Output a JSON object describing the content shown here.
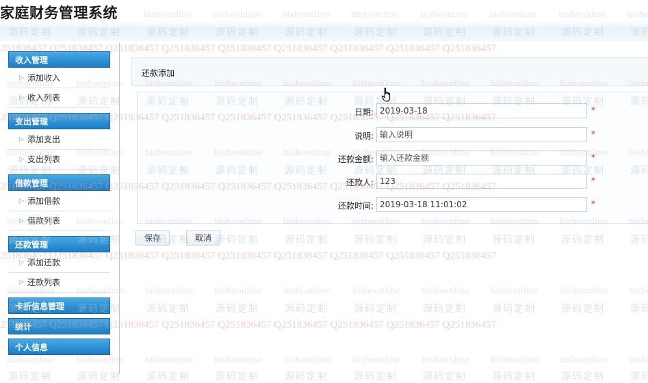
{
  "app": {
    "title": "家庭财务管理系统"
  },
  "watermark": {
    "site": "bisheonline",
    "brand": "源码定制",
    "qq": "Q2518364 57"
  },
  "sidebar": {
    "sections": [
      {
        "title": "收入管理",
        "items": [
          "添加收入",
          "收入列表"
        ]
      },
      {
        "title": "支出管理",
        "items": [
          "添加支出",
          "支出列表"
        ]
      },
      {
        "title": "借款管理",
        "items": [
          "添加借款",
          "借款列表"
        ]
      },
      {
        "title": "还款管理",
        "items": [
          "添加还款",
          "还款列表"
        ]
      },
      {
        "title": "卡折信息管理",
        "items": []
      },
      {
        "title": "统计",
        "items": []
      },
      {
        "title": "个人信息",
        "items": []
      }
    ]
  },
  "form": {
    "title": "还款添加",
    "fields": {
      "date": {
        "label": "日期:",
        "value": "2019-03-18",
        "placeholder": ""
      },
      "desc": {
        "label": "说明:",
        "value": "",
        "placeholder": "输入说明"
      },
      "amount": {
        "label": "还款金额:",
        "value": "",
        "placeholder": "输入还款金额"
      },
      "payer": {
        "label": "还款人:",
        "value": "123",
        "placeholder": ""
      },
      "time": {
        "label": "还款时间:",
        "value": "2019-03-18 11:01:02",
        "placeholder": ""
      }
    },
    "required_mark": "*",
    "buttons": {
      "save": "保存",
      "cancel": "取消"
    }
  },
  "colors": {
    "sidebar_header": "#1c7ec6",
    "required": "#e02020",
    "watermark_qq": "#e39ea0"
  },
  "icons": {
    "pointer": "hand-pointer-icon",
    "menu_arrow": "chevron-right-icon"
  }
}
